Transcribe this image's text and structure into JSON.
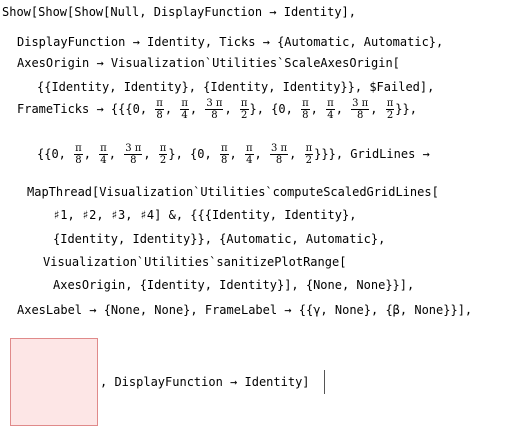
{
  "lines": {
    "l1": "Show[Show[Show[Null, DisplayFunction → Identity],",
    "l2": "DisplayFunction → Identity, Ticks → {Automatic, Automatic},",
    "l3": "AxesOrigin → Visualization`Utilities`ScaleAxesOrigin[",
    "l4": "{{Identity, Identity}, {Identity, Identity}}, $Failed],",
    "l5a": "FrameTicks → {{{0,",
    "l7a": "{{0,",
    "l7end": "}}}, GridLines →",
    "l8": "MapThread[Visualization`Utilities`computeScaledGridLines[",
    "l9": "♯1, ♯2, ♯3, ♯4] &, {{{Identity, Identity},",
    "l10": "{Identity, Identity}}, {Automatic, Automatic},",
    "l11": "Visualization`Utilities`sanitizePlotRange[",
    "l12": "AxesOrigin, {Identity, Identity}], {None, None}}],",
    "l13": "AxesLabel → {None, None}, FrameLabel → {{γ, None}, {β, None}}],",
    "l14": ", DisplayFunction → Identity]"
  },
  "fractions": {
    "pi": "π",
    "three_pi": "3 π",
    "d8": "8",
    "d4": "4",
    "d2": "2"
  }
}
